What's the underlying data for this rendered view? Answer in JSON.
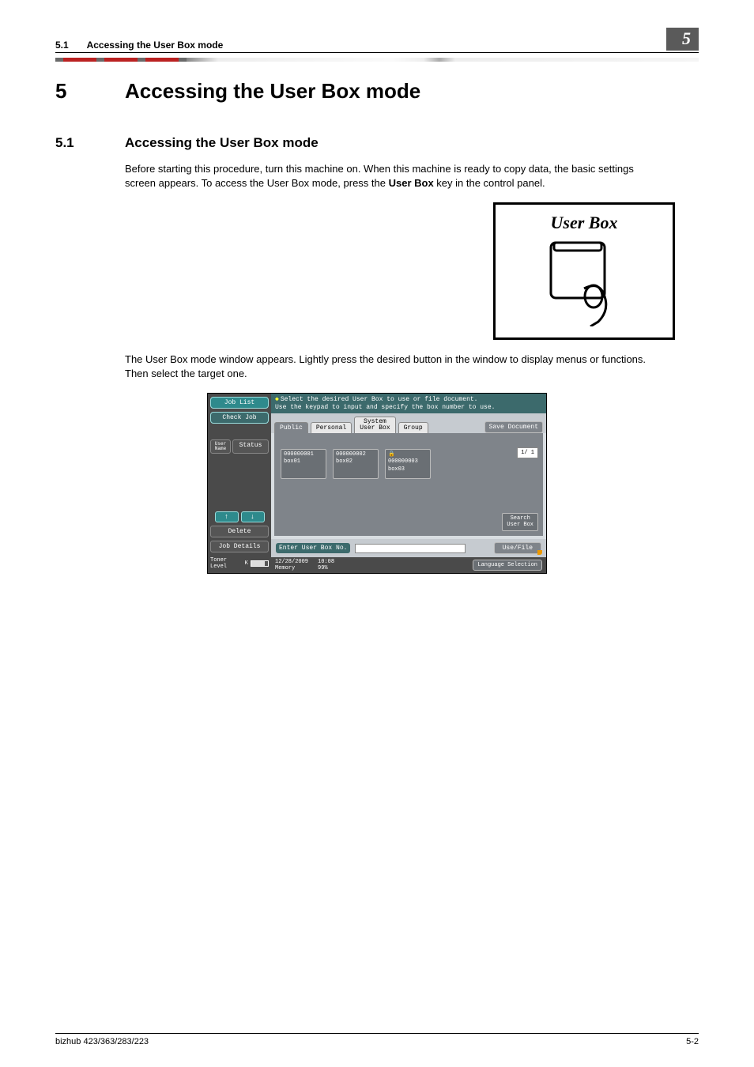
{
  "running_head": {
    "section_num": "5.1",
    "section_title": "Accessing the User Box mode",
    "chapter_num": "5"
  },
  "h1": {
    "num": "5",
    "title": "Accessing the User Box mode"
  },
  "h2": {
    "num": "5.1",
    "title": "Accessing the User Box mode"
  },
  "para1_a": "Before starting this procedure, turn this machine on. When this machine is ready to copy data, the basic settings screen appears. To access the User Box mode, press the ",
  "para1_b": "User Box",
  "para1_c": " key in the control panel.",
  "ub_label": "User Box",
  "para2": "The User Box mode window appears. Lightly press the desired button in the window to display menus or functions. Then select the target one.",
  "panel": {
    "left": {
      "job_list": "Job List",
      "check_job": "Check Job",
      "user_name": "User\nName",
      "status": "Status",
      "up": "↑",
      "down": "↓",
      "delete": "Delete",
      "job_details": "Job Details",
      "toner_label": "Toner Level",
      "toner_k": "K"
    },
    "hint_line1": "Select the desired User Box to use or file document.",
    "hint_line2": "Use the keypad to input and specify the box number to use.",
    "tabs": {
      "public": "Public",
      "personal": "Personal",
      "system": "System\nUser Box",
      "group": "Group"
    },
    "save_doc": "Save Document",
    "boxes": [
      {
        "num": "000000001",
        "name": "box01",
        "locked": false
      },
      {
        "num": "000000002",
        "name": "box02",
        "locked": false
      },
      {
        "num": "000000003",
        "name": "box03",
        "locked": true
      }
    ],
    "page": "1/  1",
    "search": "Search\nUser Box",
    "enter_label": "Enter User Box No.",
    "use_file": "Use/File",
    "status": {
      "date": "12/28/2009",
      "time": "10:08",
      "mem_label": "Memory",
      "mem_val": "99%",
      "lang": "Language Selection"
    }
  },
  "footer": {
    "left": "bizhub 423/363/283/223",
    "right": "5-2"
  }
}
